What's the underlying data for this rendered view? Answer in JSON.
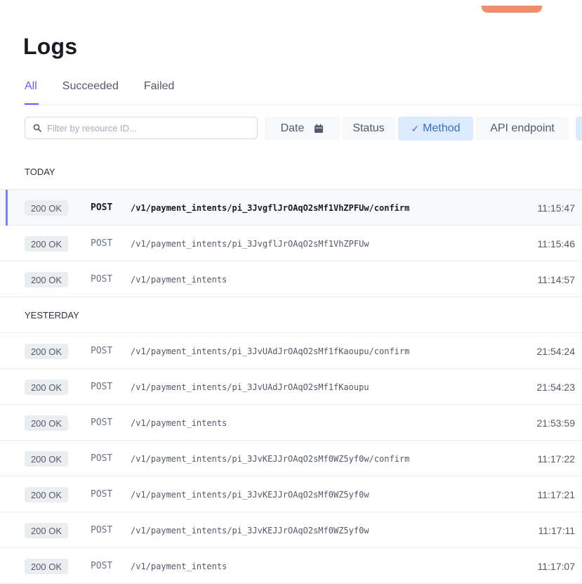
{
  "page": {
    "title": "Logs"
  },
  "tabs": [
    "All",
    "Succeeded",
    "Failed"
  ],
  "search": {
    "placeholder": "Filter by resource ID..."
  },
  "filters": {
    "date": "Date",
    "status": "Status",
    "method": "Method",
    "method_check": "✓",
    "api_endpoint": "API endpoint"
  },
  "colors": {
    "accent": "#635bff",
    "selected_chip_bg": "#dbeafe",
    "selected_chip_text": "#3b6fc0",
    "badge_bg": "#ebeef1",
    "top_accent": "#f08d6a"
  },
  "icons": {
    "search": "search-icon",
    "calendar": "calendar-icon",
    "check": "check-icon"
  },
  "groups": [
    {
      "label": "TODAY",
      "rows": [
        {
          "status": "200 OK",
          "method": "POST",
          "path": "/v1/payment_intents/pi_3JvgflJrOAqO2sMf1VhZPFUw/confirm",
          "time": "11:15:47",
          "selected": true
        },
        {
          "status": "200 OK",
          "method": "POST",
          "path": "/v1/payment_intents/pi_3JvgflJrOAqO2sMf1VhZPFUw",
          "time": "11:15:46"
        },
        {
          "status": "200 OK",
          "method": "POST",
          "path": "/v1/payment_intents",
          "time": "11:14:57"
        }
      ]
    },
    {
      "label": "YESTERDAY",
      "rows": [
        {
          "status": "200 OK",
          "method": "POST",
          "path": "/v1/payment_intents/pi_3JvUAdJrOAqO2sMf1fKaoupu/confirm",
          "time": "21:54:24"
        },
        {
          "status": "200 OK",
          "method": "POST",
          "path": "/v1/payment_intents/pi_3JvUAdJrOAqO2sMf1fKaoupu",
          "time": "21:54:23"
        },
        {
          "status": "200 OK",
          "method": "POST",
          "path": "/v1/payment_intents",
          "time": "21:53:59"
        },
        {
          "status": "200 OK",
          "method": "POST",
          "path": "/v1/payment_intents/pi_3JvKEJJrOAqO2sMf0WZ5yf0w/confirm",
          "time": "11:17:22"
        },
        {
          "status": "200 OK",
          "method": "POST",
          "path": "/v1/payment_intents/pi_3JvKEJJrOAqO2sMf0WZ5yf0w",
          "time": "11:17:21"
        },
        {
          "status": "200 OK",
          "method": "POST",
          "path": "/v1/payment_intents/pi_3JvKEJJrOAqO2sMf0WZ5yf0w",
          "time": "11:17:11"
        },
        {
          "status": "200 OK",
          "method": "POST",
          "path": "/v1/payment_intents",
          "time": "11:17:07"
        }
      ]
    }
  ]
}
